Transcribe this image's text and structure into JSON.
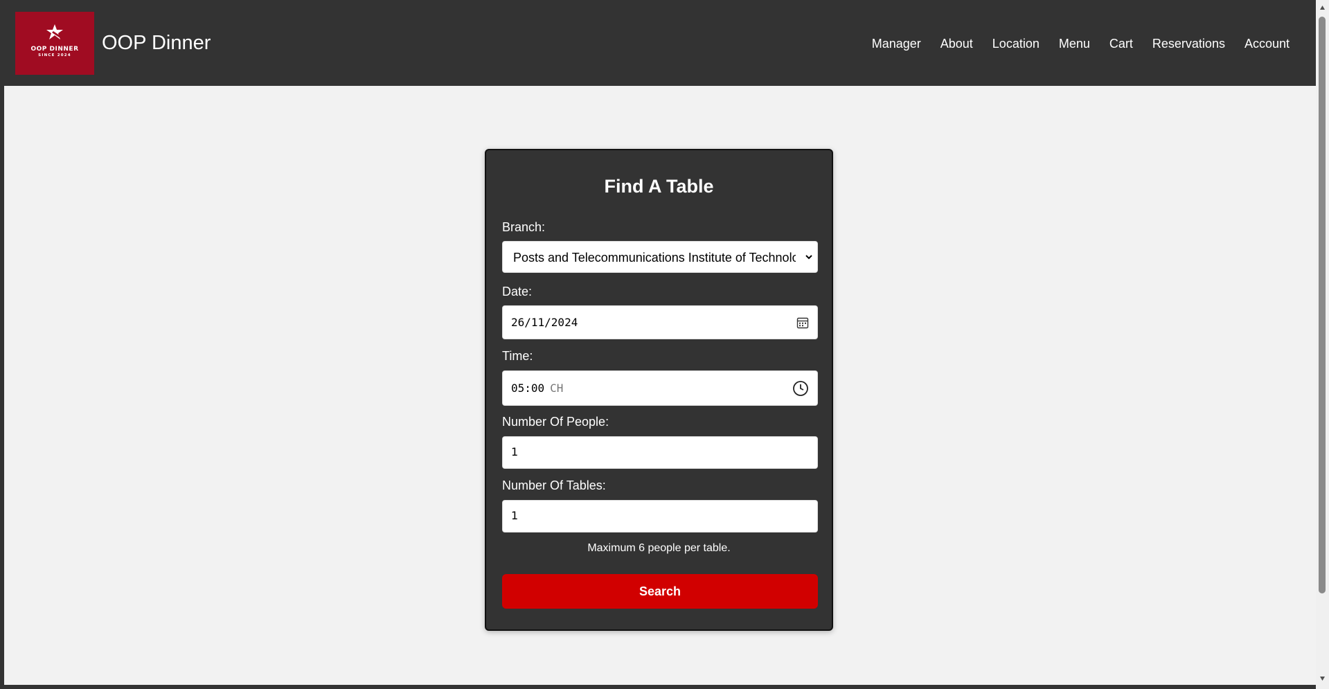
{
  "brand": {
    "logo_text": "OOP DINNER",
    "logo_subtext": "SINCE 2024",
    "name": "OOP Dinner"
  },
  "nav": {
    "items": [
      {
        "label": "Manager"
      },
      {
        "label": "About"
      },
      {
        "label": "Location"
      },
      {
        "label": "Menu"
      },
      {
        "label": "Cart"
      },
      {
        "label": "Reservations"
      },
      {
        "label": "Account"
      }
    ]
  },
  "form": {
    "title": "Find A Table",
    "branch_label": "Branch:",
    "branch_value": "Posts and Telecommunications Institute of Technology",
    "date_label": "Date:",
    "date_value": "26/11/2024",
    "time_label": "Time:",
    "time_value": "05:00",
    "time_period": "CH",
    "people_label": "Number Of People:",
    "people_value": "1",
    "tables_label": "Number Of Tables:",
    "tables_value": "1",
    "note": "Maximum 6 people per table.",
    "search_label": "Search"
  },
  "icons": {
    "branch_dropdown": "chevron-down-icon",
    "date_picker": "calendar-icon",
    "time_picker": "clock-icon"
  },
  "colors": {
    "navbar_bg": "#333333",
    "page_bg": "#f2f2f2",
    "card_bg": "#333333",
    "logo_bg": "#a00c22",
    "button_bg": "#d10000",
    "text_light": "#ffffff"
  }
}
